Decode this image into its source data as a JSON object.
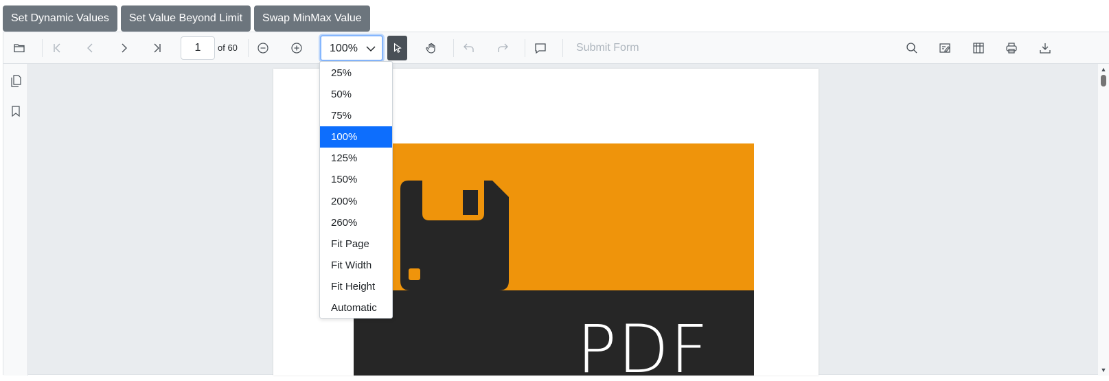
{
  "top_buttons": {
    "set_dynamic": "Set Dynamic Values",
    "set_beyond": "Set Value Beyond Limit",
    "swap_minmax": "Swap MinMax Value"
  },
  "toolbar": {
    "current_page": "1",
    "page_total": "of 60",
    "zoom_value": "100%",
    "submit_form": "Submit Form",
    "icons": [
      "open-folder-icon",
      "first-page-icon",
      "previous-page-icon",
      "next-page-icon",
      "last-page-icon",
      "zoom-out-icon",
      "zoom-in-icon",
      "text-select-icon",
      "pan-hand-icon",
      "undo-icon",
      "redo-icon",
      "comment-icon",
      "search-icon",
      "annotation-icon",
      "form-designer-icon",
      "print-icon",
      "download-icon"
    ]
  },
  "sidebar": {
    "icons": [
      "page-thumbnails-icon",
      "bookmark-icon"
    ]
  },
  "document": {
    "cover_text": "PDF",
    "accent_color": "#ef940b",
    "dark_color": "#262626"
  },
  "zoom_dropdown": {
    "selected": "100%",
    "options": [
      "25%",
      "50%",
      "75%",
      "100%",
      "125%",
      "150%",
      "200%",
      "260%",
      "Fit Page",
      "Fit Width",
      "Fit Height",
      "Automatic"
    ]
  }
}
